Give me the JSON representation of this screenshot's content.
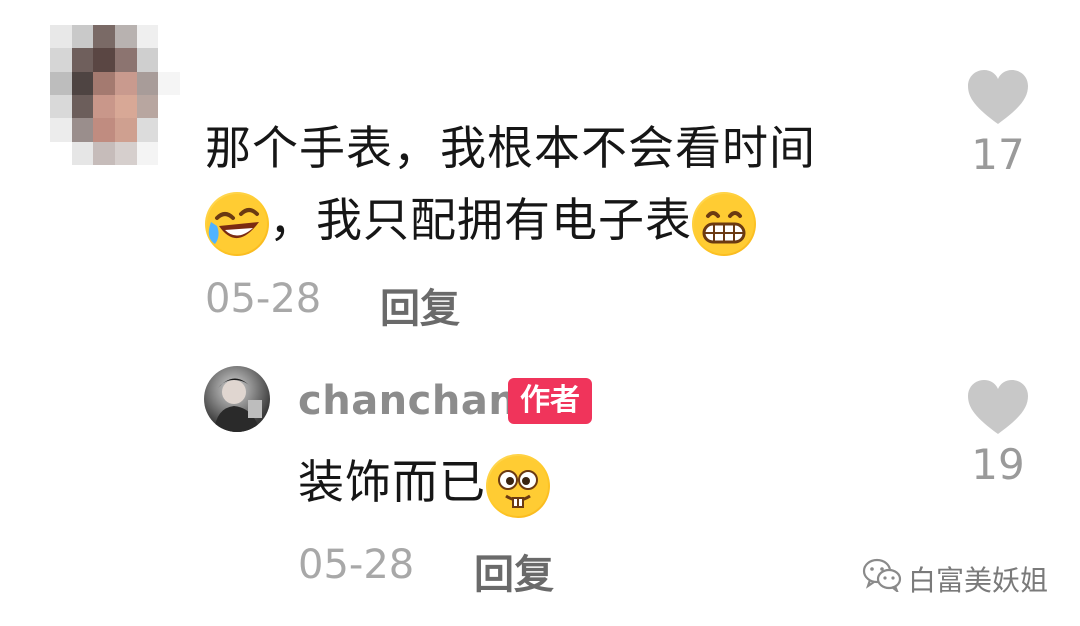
{
  "comments": [
    {
      "text_line1": "那个手表，我根本不会看时间",
      "text_line2_mid": "，我只配拥有电子表",
      "date": "05-28",
      "reply_label": "回复",
      "likes": "17",
      "emojis": [
        "laughing-crying-emoji",
        "grinning-emoji"
      ]
    }
  ],
  "reply": {
    "username": "chanchan",
    "badge": "作者",
    "text": "装饰而已",
    "date": "05-28",
    "reply_label": "回复",
    "likes": "19",
    "emojis": [
      "buck-teeth-emoji"
    ]
  },
  "watermark": {
    "text": "白富美妖姐",
    "icon": "wechat-icon"
  },
  "colors": {
    "badge_bg": "#f0345b",
    "heart": "#c8c8c8",
    "meta": "#a8a8a8"
  }
}
